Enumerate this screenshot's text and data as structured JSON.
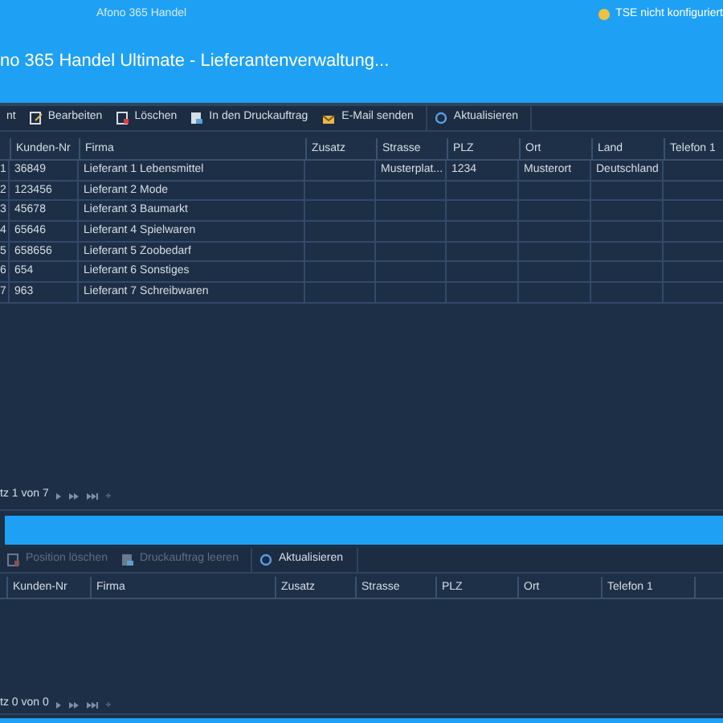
{
  "window": {
    "title": "Afono 365 Handel",
    "status": "TSE nicht konfiguriert"
  },
  "heading": "no 365 Handel Ultimate - Lieferantenverwaltung...",
  "toolbar": [
    {
      "label": "nt",
      "kind": "none",
      "disabled": false
    },
    {
      "label": "Bearbeiten",
      "kind": "edit",
      "disabled": false
    },
    {
      "label": "Löschen",
      "kind": "delete",
      "disabled": false
    },
    {
      "label": "In den Druckauftrag",
      "kind": "print",
      "disabled": false
    },
    {
      "label": "E-Mail senden",
      "kind": "mail",
      "disabled": false
    },
    {
      "label": "Aktualisieren",
      "kind": "refresh",
      "disabled": false
    }
  ],
  "table": {
    "columns": [
      "",
      "Kunden-Nr",
      "Firma",
      "Zusatz",
      "Strasse",
      "PLZ",
      "Ort",
      "Land",
      "Telefon 1"
    ],
    "rows": [
      [
        "1",
        "36849",
        "Lieferant 1 Lebensmittel",
        "",
        "Musterplat...",
        "1234",
        "Musterort",
        "Deutschland",
        ""
      ],
      [
        "2",
        "123456",
        "Lieferant 2 Mode",
        "",
        "",
        "",
        "",
        "",
        ""
      ],
      [
        "3",
        "45678",
        "Lieferant 3 Baumarkt",
        "",
        "",
        "",
        "",
        "",
        ""
      ],
      [
        "4",
        "65646",
        "Lieferant 4 Spielwaren",
        "",
        "",
        "",
        "",
        "",
        ""
      ],
      [
        "5",
        "658656",
        "Lieferant 5 Zoobedarf",
        "",
        "",
        "",
        "",
        "",
        ""
      ],
      [
        "6",
        "654",
        "Lieferant 6 Sonstiges",
        "",
        "",
        "",
        "",
        "",
        ""
      ],
      [
        "7",
        "963",
        "Lieferant 7 Schreibwaren",
        "",
        "",
        "",
        "",
        "",
        ""
      ]
    ],
    "navigator": "tz 1 von 7"
  },
  "toolbar_2": [
    {
      "label": "Position löschen",
      "kind": "delete",
      "disabled": true
    },
    {
      "label": "Druckauftrag leeren",
      "kind": "print",
      "disabled": true
    },
    {
      "label": "Aktualisieren",
      "kind": "refresh",
      "disabled": false
    }
  ],
  "table_2": {
    "columns": [
      "Kunden-Nr",
      "Firma",
      "Zusatz",
      "Strasse",
      "PLZ",
      "Ort",
      "Telefon 1"
    ],
    "navigator": "tz 0 von 0"
  }
}
